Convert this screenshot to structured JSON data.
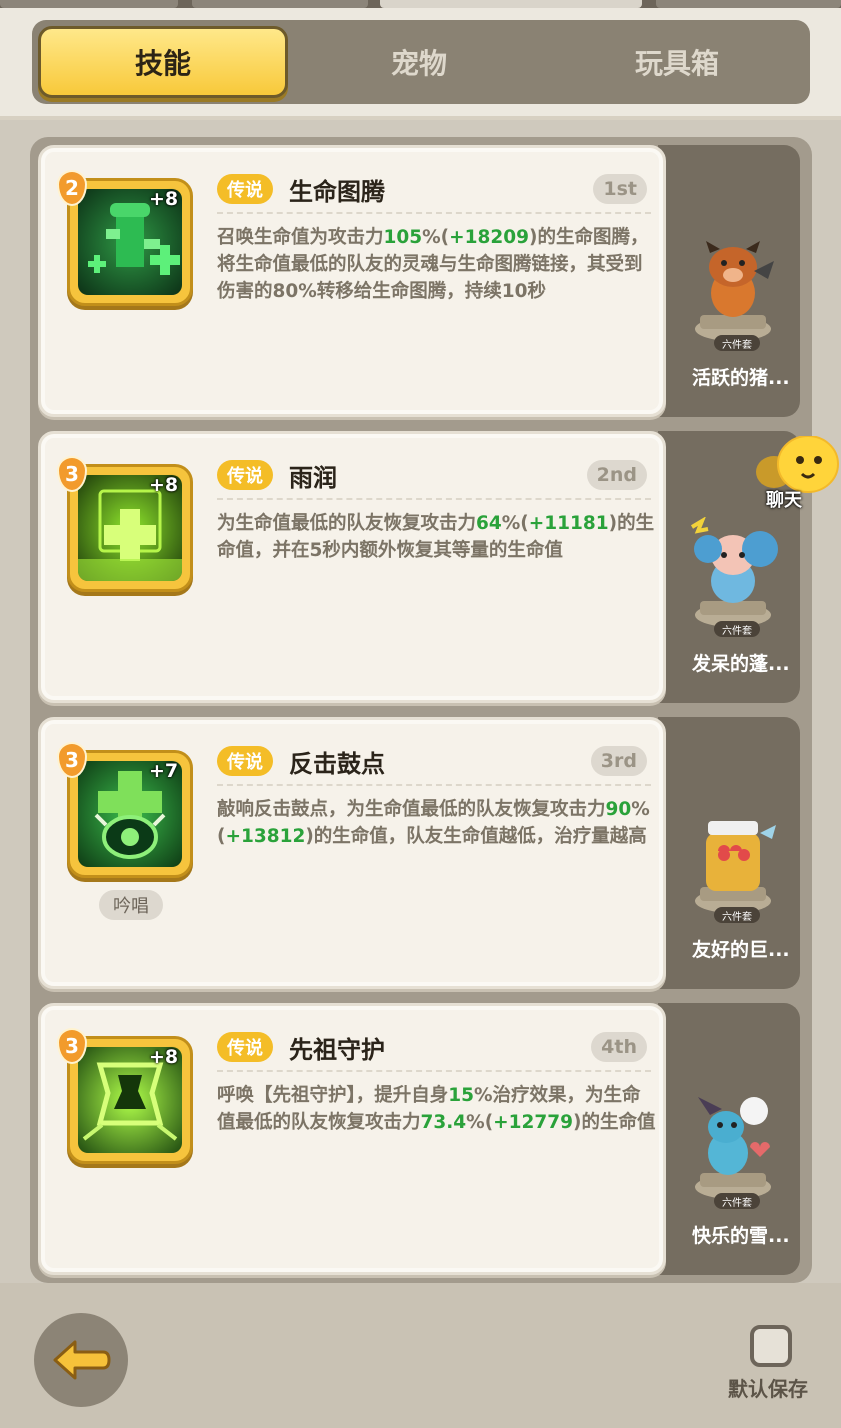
{
  "tabs": [
    {
      "label": "技能",
      "active": true
    },
    {
      "label": "宠物",
      "active": false
    },
    {
      "label": "玩具箱",
      "active": false
    }
  ],
  "skills": [
    {
      "level": "2",
      "plus": "+8",
      "rarity": "传说",
      "name": "生命图腾",
      "rank": "1st",
      "desc_parts": [
        "召唤生命值为攻击力",
        "105",
        "%(",
        "+18209",
        ")的生命图腾，将生命值最低的队友的灵魂与生命图腾链接，其受到伤害的80%转移给生命图腾，持续10秒"
      ],
      "icon": "totem-icon",
      "chant": ""
    },
    {
      "level": "3",
      "plus": "+8",
      "rarity": "传说",
      "name": "雨润",
      "rank": "2nd",
      "desc_parts": [
        "为生命值最低的队友恢复攻击力",
        "64",
        "%(",
        "+11181",
        ")的生命值，并在5秒内额外恢复其等量的生命值"
      ],
      "icon": "rain-heal-icon",
      "chant": ""
    },
    {
      "level": "3",
      "plus": "+7",
      "rarity": "传说",
      "name": "反击鼓点",
      "rank": "3rd",
      "desc_parts": [
        "敲响反击鼓点，为生命值最低的队友恢复攻击力",
        "90",
        "%(",
        "+13812",
        ")的生命值，队友生命值越低，治疗量越高"
      ],
      "icon": "drum-icon",
      "chant": "吟唱"
    },
    {
      "level": "3",
      "plus": "+8",
      "rarity": "传说",
      "name": "先祖守护",
      "rank": "4th",
      "desc_parts": [
        "呼唤【先祖守护】，提升自身",
        "15",
        "%治疗效果，为生命值最低的队友恢复攻击力",
        "73.4",
        "%(",
        "+12779",
        ")的生命值"
      ],
      "icon": "ancestor-shield-icon",
      "chant": ""
    }
  ],
  "pets": [
    {
      "name": "活跃的猪...",
      "set": "六件套",
      "icon": "boar-pet-icon"
    },
    {
      "name": "发呆的蓬...",
      "set": "六件套",
      "icon": "sheep-pet-icon"
    },
    {
      "name": "友好的巨...",
      "set": "六件套",
      "icon": "giant-pet-icon"
    },
    {
      "name": "快乐的雪...",
      "set": "六件套",
      "icon": "snow-pet-icon"
    }
  ],
  "chat": {
    "label": "聊天"
  },
  "bottom": {
    "save_label": "默认保存"
  },
  "colors": {
    "highlight": "#2aa23a",
    "rarity": "#f4bd27",
    "tab_active": "#f8c93a"
  }
}
